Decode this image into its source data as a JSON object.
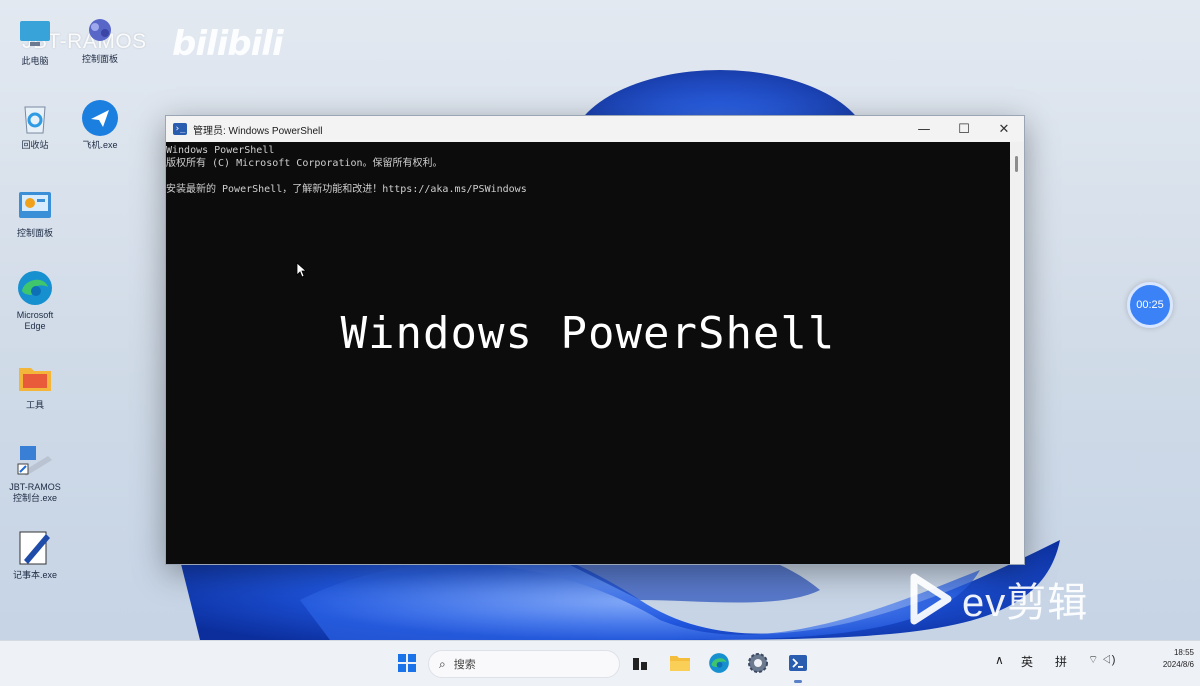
{
  "watermark": {
    "channel": "JBT-RAMOS",
    "site": "bilibili",
    "editor": "ev剪辑"
  },
  "desktop_icons": [
    {
      "name": "desktop-icon-this-pc",
      "label": "此电脑",
      "icon": "monitor-icon"
    },
    {
      "name": "desktop-icon-network",
      "label": "控制面板",
      "icon": "network-icon"
    },
    {
      "name": "desktop-icon-recycle-bin",
      "label": "回收站",
      "icon": "recycle-bin-icon"
    },
    {
      "name": "desktop-icon-feiji",
      "label": "飞机.exe",
      "icon": "plane-icon"
    },
    {
      "name": "desktop-icon-control",
      "label": "控制面板",
      "icon": "control-panel-icon"
    },
    {
      "name": "desktop-icon-edge",
      "label": "Microsoft\nEdge",
      "icon": "edge-icon"
    },
    {
      "name": "desktop-icon-folder",
      "label": "工具",
      "icon": "folder-icon"
    },
    {
      "name": "desktop-icon-jbt",
      "label": "JBT-RAMOS\n控制台.exe",
      "icon": "shortcut-icon"
    },
    {
      "name": "desktop-icon-editor",
      "label": "记事本.exe",
      "icon": "notepad-icon"
    }
  ],
  "powershell": {
    "title": "管理员: Windows PowerShell",
    "lines": [
      "Windows PowerShell",
      "版权所有 (C) Microsoft Corporation。保留所有权利。",
      "",
      "安装最新的 PowerShell，了解新功能和改进！https://aka.ms/PSWindows"
    ],
    "overlay_caption": "Windows PowerShell",
    "minimize_label": "—",
    "maximize_label": "☐",
    "close_label": "✕"
  },
  "timer": {
    "label": "00:25"
  },
  "taskbar": {
    "search_placeholder": "搜索",
    "apps": [
      "start-icon",
      "task-view-icon",
      "file-explorer-icon",
      "edge-icon",
      "settings-icon",
      "powershell-icon"
    ],
    "tray": {
      "chevron": "∧",
      "ime_lang": "英",
      "ime_mode": "拼",
      "network_sound": "⌔ ◁)"
    },
    "clock": {
      "time": "18:55",
      "date": "2024/8/6"
    }
  },
  "colors": {
    "accent": "#3b82f6",
    "terminal_bg": "#0c0c0c",
    "wallpaper_blue": "#1a4fd8"
  }
}
